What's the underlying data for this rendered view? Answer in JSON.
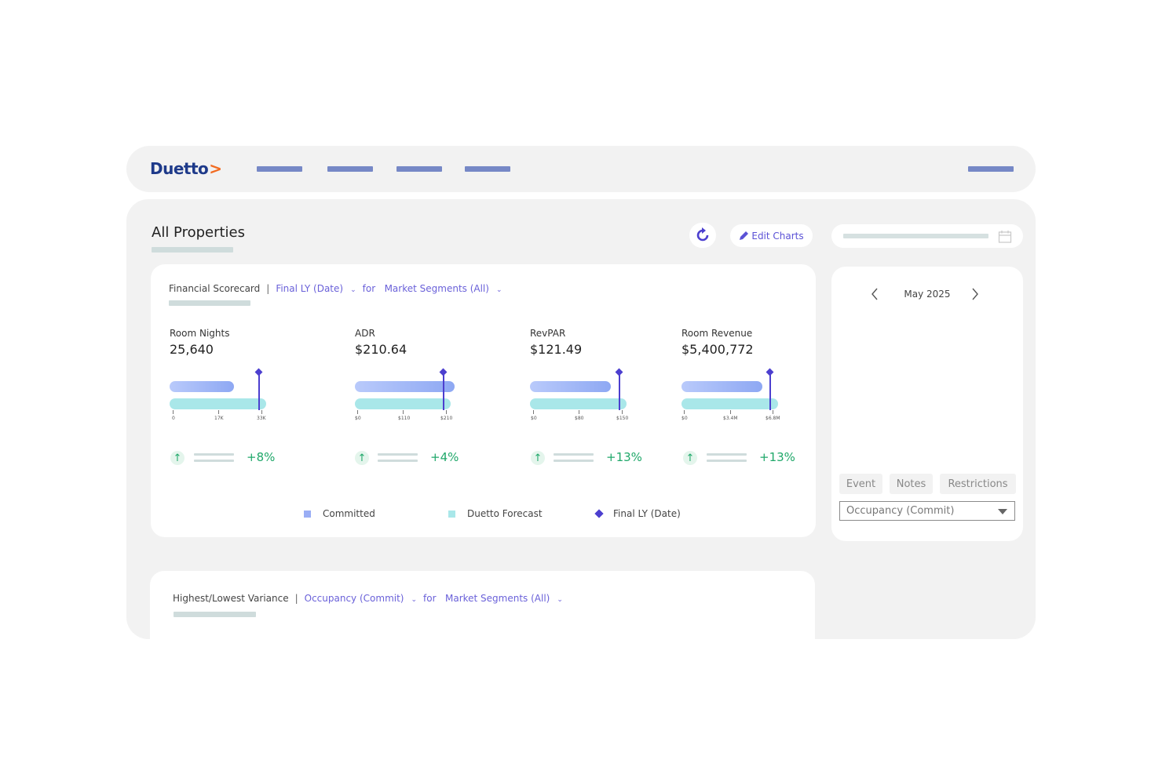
{
  "brand": {
    "name": "Duetto",
    "mark": ">",
    "brand_color": "#1e3a8a",
    "accent_color": "#f26b21"
  },
  "header": {
    "title": "All Properties",
    "refresh_icon": "refresh-icon",
    "edit_label": "Edit Charts",
    "edit_icon": "pencil-icon"
  },
  "scorecard": {
    "title": "Financial Scorecard",
    "separator": "|",
    "compare": "Final LY (Date)",
    "for_label": "for",
    "segment": "Market Segments (All)",
    "metrics": [
      {
        "label": "Room Nights",
        "value": "25,640",
        "ticks": [
          "0",
          "17K",
          "33K"
        ],
        "change": "+8%"
      },
      {
        "label": "ADR",
        "value": "$210.64",
        "ticks": [
          "$0",
          "$110",
          "$210"
        ],
        "change": "+4%"
      },
      {
        "label": "RevPAR",
        "value": "$121.49",
        "ticks": [
          "$0",
          "$80",
          "$150"
        ],
        "change": "+13%"
      },
      {
        "label": "Room Revenue",
        "value": "$5,400,772",
        "ticks": [
          "$0",
          "$3.4M",
          "$6.8M"
        ],
        "change": "+13%"
      }
    ],
    "legend": [
      "Committed",
      "Duetto Forecast",
      "Final LY (Date)"
    ],
    "colors": {
      "committed": "#9aaef5",
      "forecast": "#a9e7e9",
      "final_ly": "#4c3fcf",
      "positive": "#20a86a"
    }
  },
  "calendar": {
    "month": "May 2025",
    "tabs": [
      "Event",
      "Notes",
      "Restrictions"
    ],
    "select_value": "Occupancy (Commit)"
  },
  "variance": {
    "title": "Highest/Lowest Variance",
    "separator": "|",
    "metric": "Occupancy (Commit)",
    "for_label": "for",
    "segment": "Market Segments (All)"
  }
}
